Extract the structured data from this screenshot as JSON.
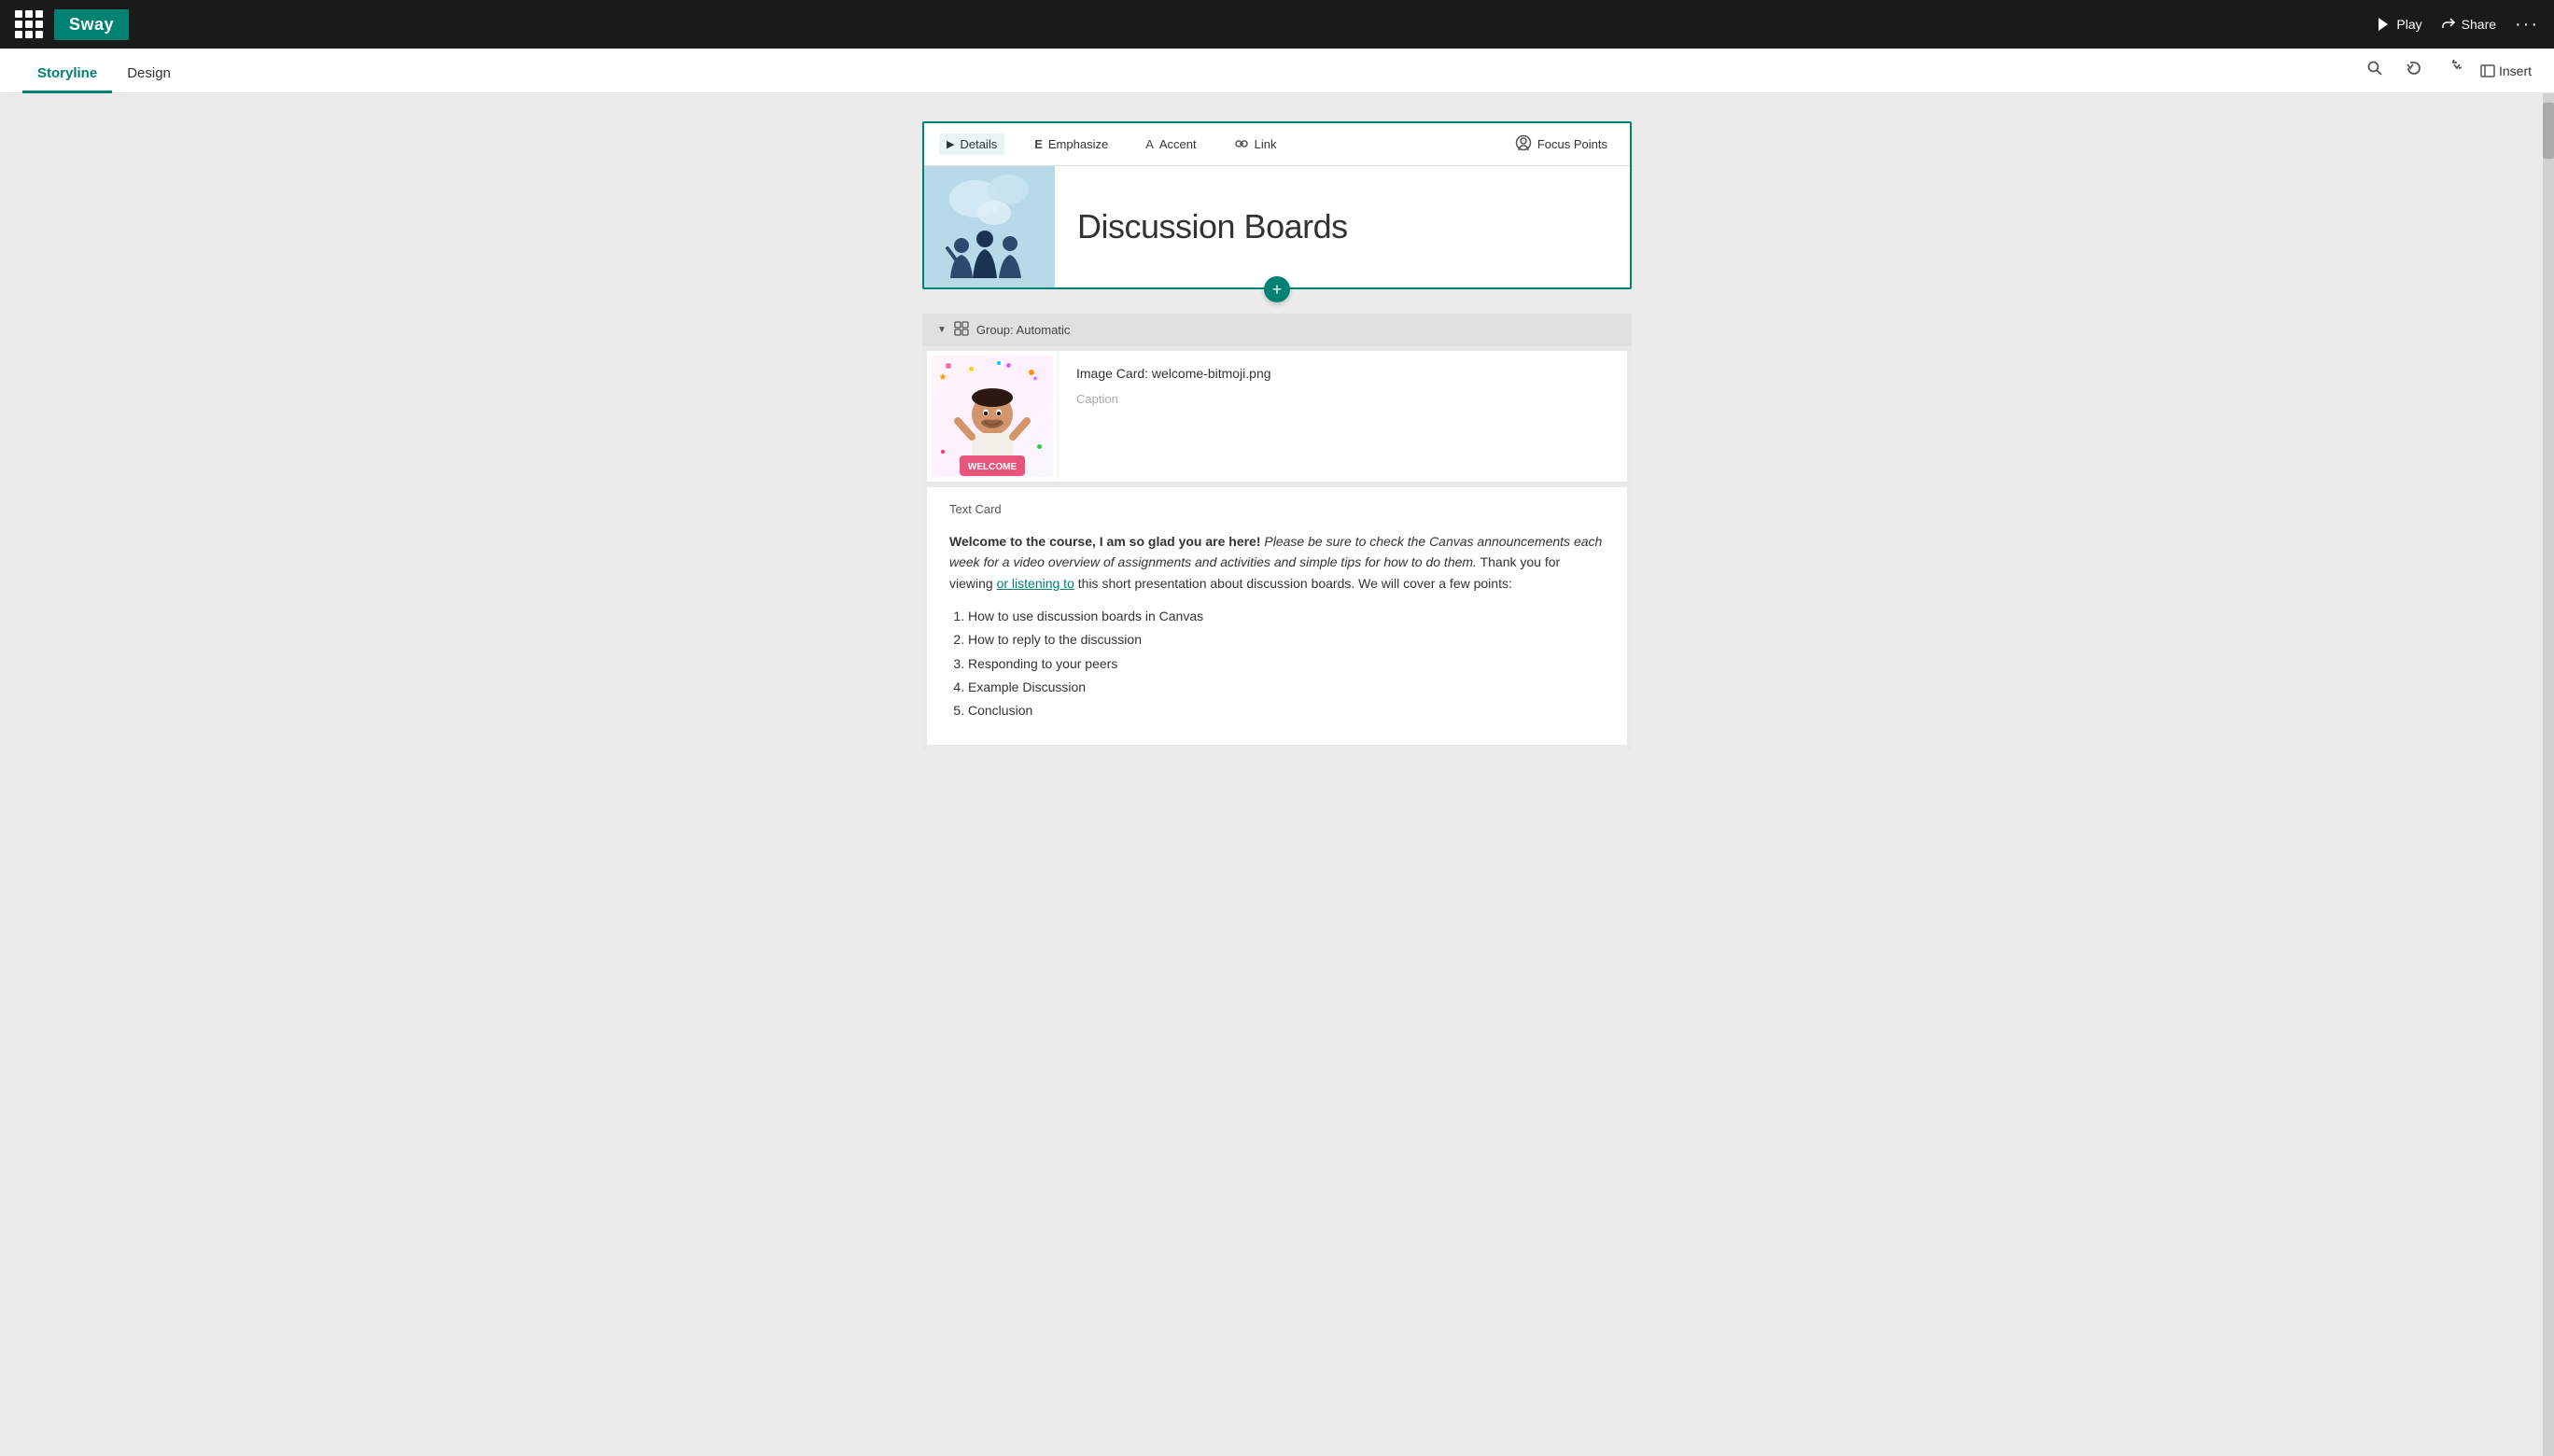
{
  "app": {
    "name": "Sway",
    "bg_color": "#008272"
  },
  "topbar": {
    "play_label": "Play",
    "share_label": "Share",
    "more_label": "···"
  },
  "tabs": {
    "storyline_label": "Storyline",
    "design_label": "Design",
    "active": "storyline"
  },
  "toolbar_right": {
    "insert_label": "Insert"
  },
  "details_card": {
    "expand_label": "Details",
    "emphasize_label": "Emphasize",
    "accent_label": "Accent",
    "link_label": "Link",
    "focus_points_label": "Focus Points",
    "title": "Discussion Boards"
  },
  "plus_button": {
    "label": "+"
  },
  "group": {
    "label": "Group: Automatic"
  },
  "image_card": {
    "title": "Image Card: welcome-bitmoji.png",
    "caption_placeholder": "Caption"
  },
  "text_card": {
    "title": "Text Card",
    "bold_part": "Welcome to the course, I am so glad you are here!",
    "italic_part": " Please be sure to check the Canvas announcements each week for a video overview of assignments and activities and simple tips for how to do them.",
    "normal_part": " Thank you for viewing ",
    "link_text": "or listening to",
    "end_part": " this short presentation about discussion boards. We will cover a few points:",
    "list_items": [
      "How to use discussion boards in Canvas",
      "How to reply to the discussion",
      "Responding to your peers",
      "Example Discussion",
      "Conclusion"
    ]
  }
}
